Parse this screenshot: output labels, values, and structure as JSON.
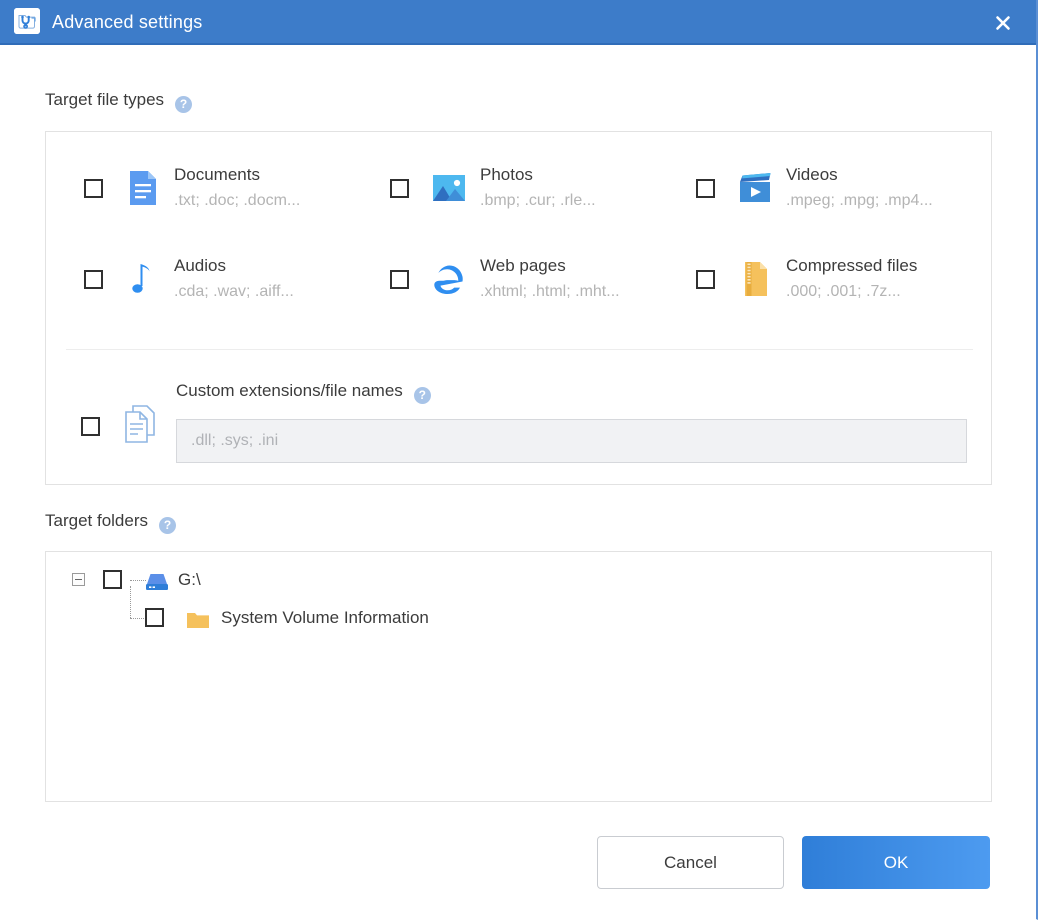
{
  "window": {
    "title": "Advanced settings",
    "app_icon": "recovery-app-icon",
    "close_label": "close-icon",
    "header_color": "#3d7cc9",
    "accent_color": "#2f7ed8"
  },
  "sections": {
    "file_types": {
      "label": "Target file types",
      "help": "?"
    },
    "folders": {
      "label": "Target folders",
      "help": "?"
    }
  },
  "file_types": [
    {
      "id": "documents",
      "name": "Documents",
      "extensions": ".txt; .doc; .docm...",
      "icon": "document-icon",
      "checked": false
    },
    {
      "id": "photos",
      "name": "Photos",
      "extensions": ".bmp; .cur; .rle...",
      "icon": "photo-icon",
      "checked": false
    },
    {
      "id": "videos",
      "name": "Videos",
      "extensions": ".mpeg; .mpg; .mp4...",
      "icon": "video-icon",
      "checked": false
    },
    {
      "id": "audios",
      "name": "Audios",
      "extensions": ".cda; .wav; .aiff...",
      "icon": "audio-icon",
      "checked": false
    },
    {
      "id": "web-pages",
      "name": "Web pages",
      "extensions": ".xhtml; .html; .mht...",
      "icon": "browser-icon",
      "checked": false
    },
    {
      "id": "compressed-files",
      "name": "Compressed files",
      "extensions": ".000; .001; .7z...",
      "icon": "archive-icon",
      "checked": false
    }
  ],
  "custom": {
    "label": "Custom extensions/file names",
    "help": "?",
    "icon": "multi-document-icon",
    "checked": false,
    "value": "",
    "placeholder": ".dll; .sys; .ini"
  },
  "folder_tree": [
    {
      "id": "drive-g",
      "label": "G:\\",
      "icon": "drive-icon",
      "checked": false,
      "expanded": true,
      "depth": 0
    },
    {
      "id": "svi",
      "label": "System Volume Information",
      "icon": "folder-icon",
      "checked": false,
      "expanded": false,
      "depth": 1
    }
  ],
  "footer": {
    "cancel_label": "Cancel",
    "ok_label": "OK"
  }
}
